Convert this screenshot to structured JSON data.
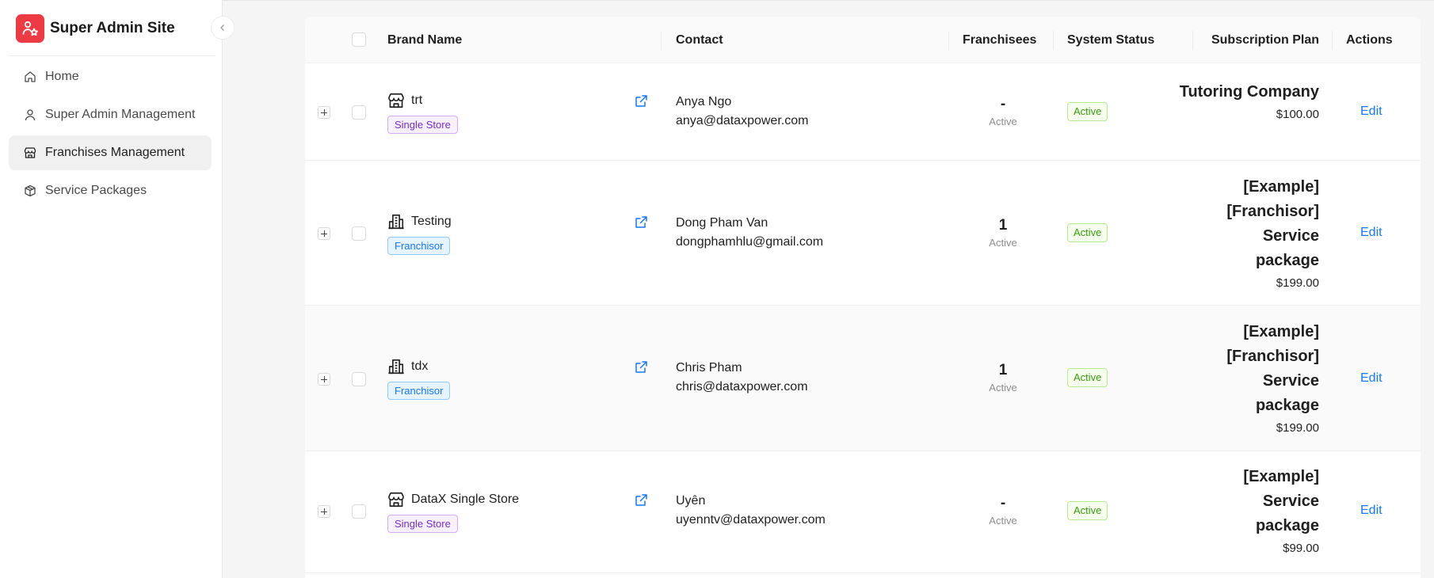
{
  "sidebar": {
    "title": "Super Admin Site",
    "nav": [
      {
        "label": "Home",
        "icon": "home-icon"
      },
      {
        "label": "Super Admin Management",
        "icon": "user-icon"
      },
      {
        "label": "Franchises Management",
        "icon": "store-icon",
        "active": true
      },
      {
        "label": "Service Packages",
        "icon": "package-icon"
      }
    ]
  },
  "table": {
    "headers": {
      "brand": "Brand Name",
      "contact": "Contact",
      "franchisees": "Franchisees",
      "status": "System Status",
      "plan": "Subscription Plan",
      "actions": "Actions"
    },
    "rows": [
      {
        "name": "trt",
        "type": "Single Store",
        "type_icon": "store-icon",
        "contact_name": "Anya Ngo",
        "email": "anya@dataxpower.com",
        "franchisees": "-",
        "franchisees_label": "Active",
        "status": "Active",
        "plan": "Tutoring Company",
        "price": "$100.00",
        "action": "Edit"
      },
      {
        "name": "Testing",
        "type": "Franchisor",
        "type_icon": "building-icon",
        "contact_name": "Dong Pham Van",
        "email": "dongphamhlu@gmail.com",
        "franchisees": "1",
        "franchisees_label": "Active",
        "status": "Active",
        "plan": "[Example] [Franchisor] Service package",
        "price": "$199.00",
        "action": "Edit"
      },
      {
        "name": "tdx",
        "type": "Franchisor",
        "type_icon": "building-icon",
        "contact_name": "Chris Pham",
        "email": "chris@dataxpower.com",
        "franchisees": "1",
        "franchisees_label": "Active",
        "status": "Active",
        "plan": "[Example] [Franchisor] Service package",
        "price": "$199.00",
        "action": "Edit"
      },
      {
        "name": "DataX Single Store",
        "type": "Single Store",
        "type_icon": "store-icon",
        "contact_name": "Uyên",
        "email": "uyenntv@dataxpower.com",
        "franchisees": "-",
        "franchisees_label": "Active",
        "status": "Active",
        "plan": "[Example] Service package",
        "price": "$99.00",
        "action": "Edit"
      }
    ]
  },
  "colors": {
    "brand": "#ee3b43",
    "link": "#1677ff",
    "status": "#389e0d"
  }
}
